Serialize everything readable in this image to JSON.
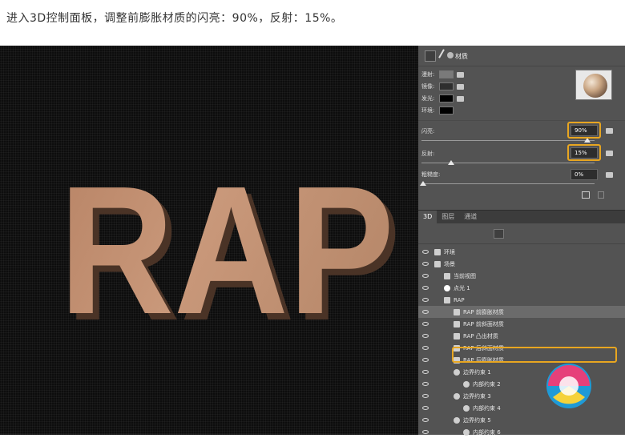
{
  "caption": "进入3D控制面板，调整前膨胀材质的闪亮：90%，反射：15%。",
  "canvas": {
    "text": "RAP"
  },
  "properties": {
    "title": "材质",
    "rows": [
      {
        "label": "漫射:",
        "color": "#7a7a7a"
      },
      {
        "label": "镜像:",
        "color": "#2e2e2e"
      },
      {
        "label": "发光:",
        "color": "#000000"
      },
      {
        "label": "环境:",
        "color": "#000000"
      }
    ],
    "shine": {
      "label": "闪亮:",
      "value": "90%",
      "level": 0.9
    },
    "reflection": {
      "label": "反射:",
      "value": "15%",
      "level": 0.15
    },
    "roughness": {
      "label": "粗糙度:",
      "value": "0%",
      "level": 0.0
    }
  },
  "layers": {
    "tabs": [
      "3D",
      "图层",
      "通道"
    ],
    "items": [
      {
        "label": "环境",
        "indent": 0,
        "icon": "environment-icon"
      },
      {
        "label": "场景",
        "indent": 0,
        "icon": "scene-icon"
      },
      {
        "label": "当前视图",
        "indent": 1,
        "icon": "camera-icon"
      },
      {
        "label": "点光 1",
        "indent": 1,
        "icon": "bulb-icon"
      },
      {
        "label": "RAP",
        "indent": 1,
        "icon": "mesh-icon"
      },
      {
        "label": "RAP 前膨胀材质",
        "indent": 2,
        "icon": "material-icon"
      },
      {
        "label": "RAP 前斜面材质",
        "indent": 2,
        "icon": "material-icon"
      },
      {
        "label": "RAP 凸出材质",
        "indent": 2,
        "icon": "material-icon"
      },
      {
        "label": "RAP 后斜面材质",
        "indent": 2,
        "icon": "material-icon"
      },
      {
        "label": "RAP 后膨胀材质",
        "indent": 2,
        "icon": "material-icon"
      },
      {
        "label": "边界约束 1",
        "indent": 2,
        "icon": "constraint-icon"
      },
      {
        "label": "内部约束 2",
        "indent": 3,
        "icon": "constraint-icon"
      },
      {
        "label": "边界约束 3",
        "indent": 2,
        "icon": "constraint-icon"
      },
      {
        "label": "内部约束 4",
        "indent": 3,
        "icon": "constraint-icon"
      },
      {
        "label": "边界约束 5",
        "indent": 2,
        "icon": "constraint-icon"
      },
      {
        "label": "内部约束 6",
        "indent": 3,
        "icon": "constraint-icon"
      }
    ]
  },
  "colors": {
    "highlight": "#e8a620",
    "panel": "#535353",
    "text_copper": "#c8967a"
  }
}
